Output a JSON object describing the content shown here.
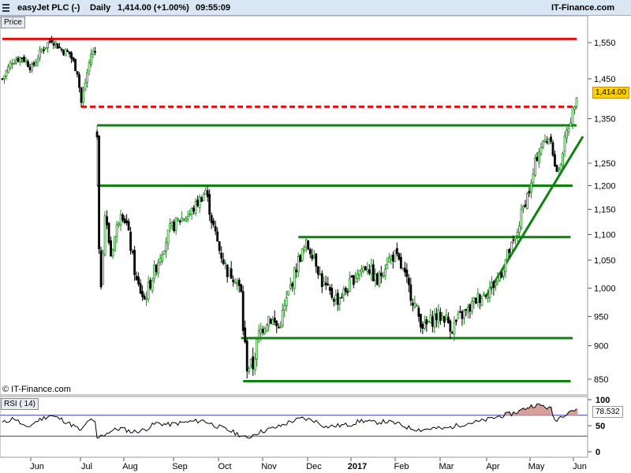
{
  "header": {
    "instrument": "easyJet PLC (-)",
    "period": "Daily",
    "quote": "1,414.00 (+1.00%)",
    "time": "09:55:09",
    "brand": "IT-Finance.com"
  },
  "price_pane": {
    "label": "Price",
    "copyright": "© IT-Finance.com",
    "last_value_label": "1,414.00"
  },
  "rsi_pane": {
    "label": "RSI ( 14)",
    "value_label": "78.532"
  },
  "colors": {
    "header_bg": "#d9e6f4",
    "resistance_red": "#e01010",
    "support_green": "#108010",
    "candle_up": "#1a8a1a",
    "candle_down": "#000000",
    "rsi_fill": "#d9a09a",
    "value_badge": "#ffd000"
  },
  "chart_data": [
    {
      "type": "candlestick",
      "title": "easyJet PLC (-)",
      "x_tick_labels": [
        "Jun",
        "Jul",
        "Aug",
        "Sep",
        "Oct",
        "Nov",
        "Dec",
        "2017",
        "Feb",
        "Mar",
        "Apr",
        "May",
        "Jun"
      ],
      "y_tick_labels": [
        "1,550",
        "1,450",
        "1,350",
        "1,250",
        "1,200",
        "1,150",
        "1,100",
        "1,050",
        "1,000",
        "950",
        "900",
        "850"
      ],
      "y_ticks": [
        1550,
        1450,
        1350,
        1250,
        1200,
        1150,
        1100,
        1050,
        1000,
        950,
        900,
        850
      ],
      "last_value": 1414,
      "close_path": [
        [
          0,
          1450
        ],
        [
          5,
          1500
        ],
        [
          10,
          1510
        ],
        [
          15,
          1480
        ],
        [
          20,
          1530
        ],
        [
          25,
          1560
        ],
        [
          30,
          1530
        ],
        [
          34,
          1520
        ],
        [
          38,
          1470
        ],
        [
          40,
          1390
        ],
        [
          42,
          1440
        ],
        [
          45,
          1520
        ],
        [
          47,
          1525
        ],
        [
          48,
          1320
        ],
        [
          49,
          1060
        ],
        [
          50,
          1010
        ],
        [
          52,
          1140
        ],
        [
          55,
          1060
        ],
        [
          60,
          1150
        ],
        [
          63,
          1120
        ],
        [
          68,
          1010
        ],
        [
          72,
          980
        ],
        [
          76,
          1020
        ],
        [
          80,
          1060
        ],
        [
          85,
          1110
        ],
        [
          90,
          1130
        ],
        [
          95,
          1140
        ],
        [
          100,
          1170
        ],
        [
          103,
          1190
        ],
        [
          106,
          1130
        ],
        [
          110,
          1070
        ],
        [
          114,
          1030
        ],
        [
          118,
          1020
        ],
        [
          121,
          990
        ],
        [
          122,
          930
        ],
        [
          124,
          870
        ],
        [
          127,
          870
        ],
        [
          130,
          920
        ],
        [
          135,
          950
        ],
        [
          140,
          930
        ],
        [
          145,
          990
        ],
        [
          150,
          1050
        ],
        [
          154,
          1080
        ],
        [
          158,
          1060
        ],
        [
          162,
          1010
        ],
        [
          166,
          990
        ],
        [
          170,
          980
        ],
        [
          175,
          1000
        ],
        [
          180,
          1030
        ],
        [
          185,
          1040
        ],
        [
          190,
          1010
        ],
        [
          195,
          1050
        ],
        [
          199,
          1060
        ],
        [
          203,
          1030
        ],
        [
          207,
          990
        ],
        [
          211,
          950
        ],
        [
          214,
          930
        ],
        [
          216,
          940
        ],
        [
          220,
          950
        ],
        [
          224,
          950
        ],
        [
          228,
          930
        ],
        [
          232,
          950
        ],
        [
          236,
          960
        ],
        [
          240,
          980
        ],
        [
          244,
          990
        ],
        [
          247,
          1000
        ],
        [
          250,
          1010
        ],
        [
          253,
          1030
        ],
        [
          256,
          1060
        ],
        [
          260,
          1090
        ],
        [
          263,
          1140
        ],
        [
          266,
          1180
        ],
        [
          268,
          1200
        ],
        [
          270,
          1250
        ],
        [
          272,
          1280
        ],
        [
          275,
          1300
        ],
        [
          278,
          1310
        ],
        [
          280,
          1240
        ],
        [
          282,
          1230
        ],
        [
          284,
          1280
        ],
        [
          286,
          1320
        ],
        [
          288,
          1350
        ],
        [
          290,
          1390
        ],
        [
          291,
          1414
        ]
      ],
      "horizontal_levels": [
        {
          "value": 1560,
          "style": "solid",
          "color": "red",
          "from_day": 0,
          "to_day": 291
        },
        {
          "value": 1380,
          "style": "dashed",
          "color": "red",
          "from_day": 40,
          "to_day": 291
        },
        {
          "value": 1335,
          "style": "solid",
          "color": "green",
          "from_day": 48,
          "to_day": 291
        },
        {
          "value": 1200,
          "style": "solid",
          "color": "green",
          "from_day": 48,
          "to_day": 289
        },
        {
          "value": 1095,
          "style": "solid",
          "color": "green",
          "from_day": 150,
          "to_day": 288
        },
        {
          "value": 913,
          "style": "solid",
          "color": "green",
          "from_day": 121,
          "to_day": 289
        },
        {
          "value": 847,
          "style": "solid",
          "color": "green",
          "from_day": 122,
          "to_day": 288
        }
      ],
      "trendline": {
        "from": [
          245,
          985
        ],
        "to": [
          291,
          1310
        ],
        "color": "green"
      }
    },
    {
      "type": "line",
      "title": "RSI ( 14)",
      "y_tick_labels": [
        "100",
        "50",
        "0"
      ],
      "y_ticks": [
        100,
        50,
        0
      ],
      "overbought": 70,
      "oversold": 30,
      "last_value": 78.532,
      "values": [
        [
          0,
          55
        ],
        [
          6,
          65
        ],
        [
          12,
          45
        ],
        [
          18,
          60
        ],
        [
          24,
          70
        ],
        [
          30,
          62
        ],
        [
          36,
          50
        ],
        [
          40,
          40
        ],
        [
          44,
          62
        ],
        [
          47,
          55
        ],
        [
          48,
          25
        ],
        [
          50,
          30
        ],
        [
          55,
          40
        ],
        [
          60,
          45
        ],
        [
          66,
          38
        ],
        [
          72,
          42
        ],
        [
          78,
          55
        ],
        [
          84,
          52
        ],
        [
          90,
          55
        ],
        [
          96,
          58
        ],
        [
          102,
          60
        ],
        [
          108,
          50
        ],
        [
          114,
          42
        ],
        [
          120,
          33
        ],
        [
          124,
          25
        ],
        [
          128,
          35
        ],
        [
          134,
          42
        ],
        [
          140,
          48
        ],
        [
          146,
          58
        ],
        [
          152,
          64
        ],
        [
          158,
          60
        ],
        [
          164,
          48
        ],
        [
          170,
          50
        ],
        [
          176,
          52
        ],
        [
          182,
          60
        ],
        [
          188,
          56
        ],
        [
          194,
          58
        ],
        [
          200,
          54
        ],
        [
          206,
          46
        ],
        [
          212,
          42
        ],
        [
          218,
          45
        ],
        [
          224,
          44
        ],
        [
          230,
          50
        ],
        [
          236,
          55
        ],
        [
          242,
          58
        ],
        [
          246,
          62
        ],
        [
          250,
          66
        ],
        [
          254,
          70
        ],
        [
          258,
          73
        ],
        [
          262,
          78
        ],
        [
          266,
          85
        ],
        [
          270,
          90
        ],
        [
          274,
          88
        ],
        [
          278,
          82
        ],
        [
          280,
          60
        ],
        [
          284,
          70
        ],
        [
          288,
          80
        ],
        [
          291,
          78.532
        ]
      ]
    }
  ]
}
